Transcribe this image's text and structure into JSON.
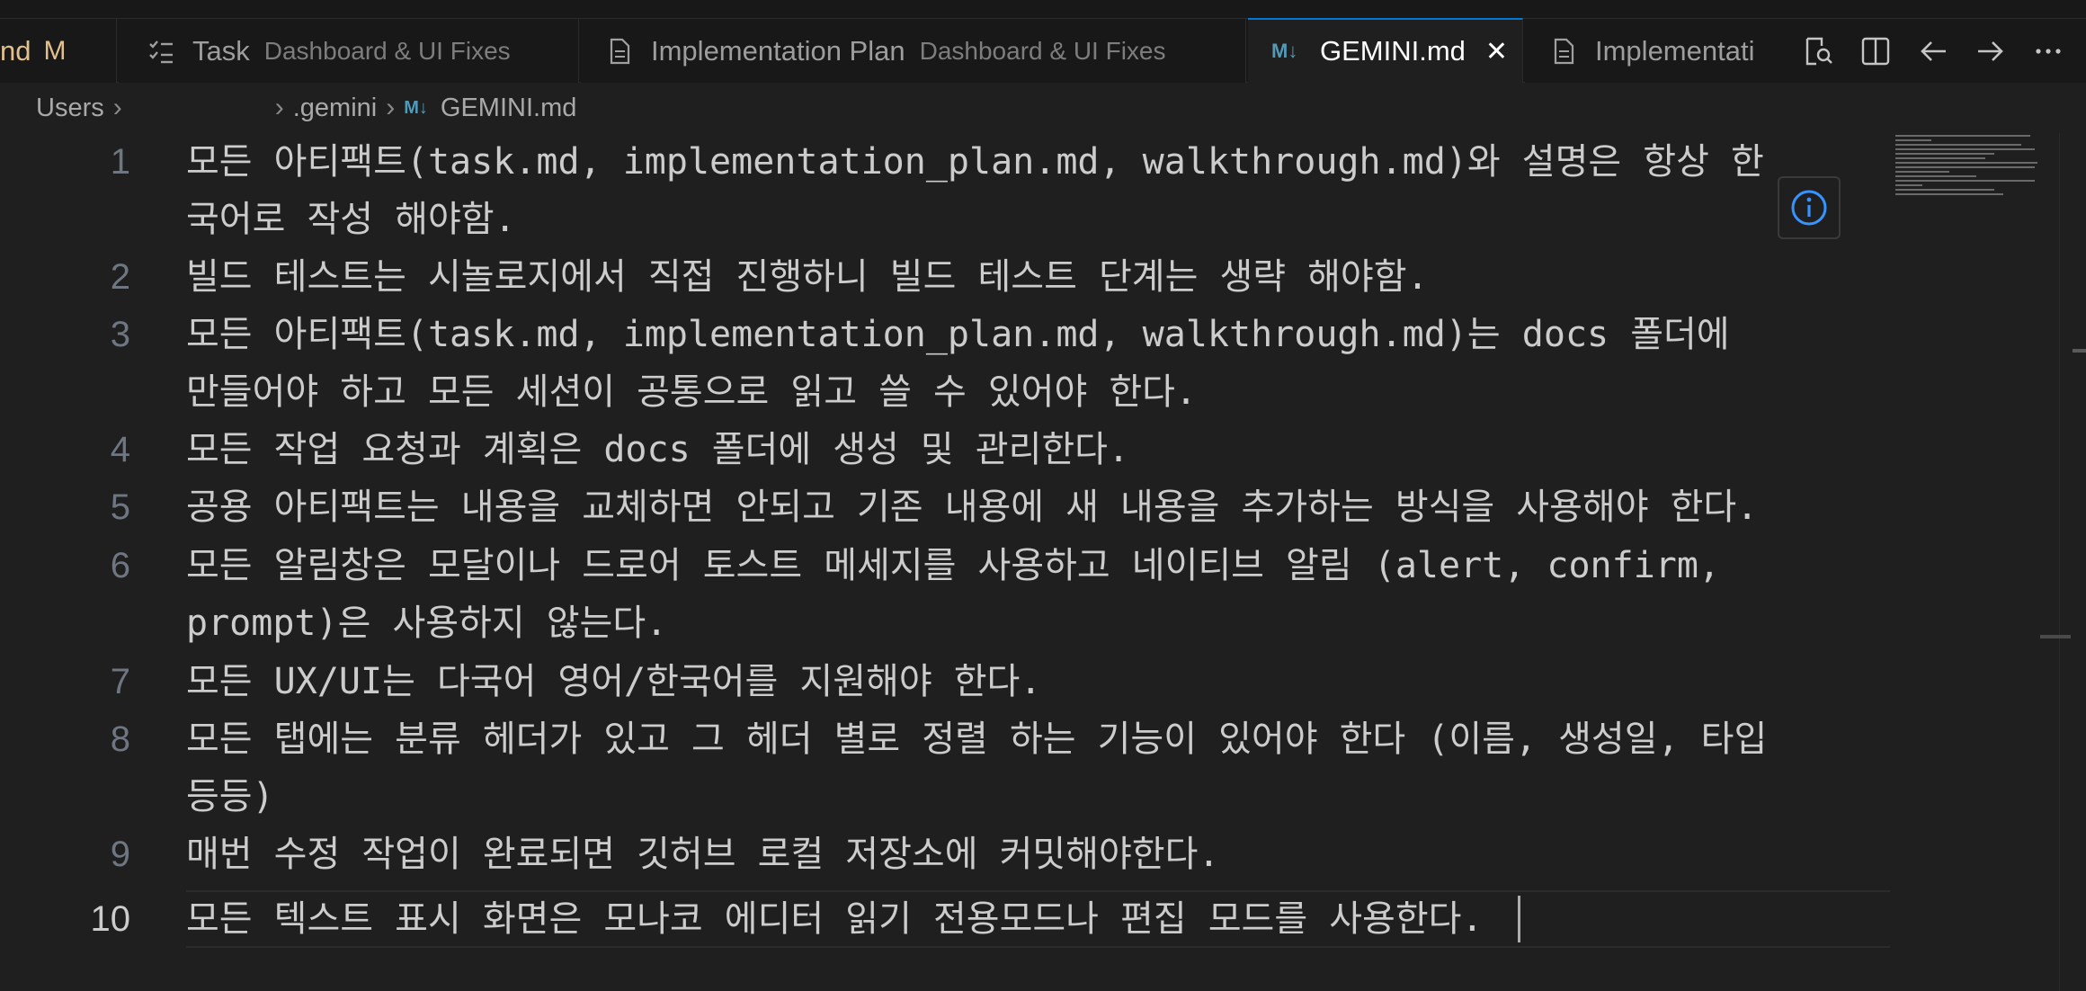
{
  "tabs": [
    {
      "label": "nd",
      "badge": "M"
    },
    {
      "label": "Task",
      "description": "Dashboard & UI Fixes",
      "icon": "checklist-icon"
    },
    {
      "label": "Implementation Plan",
      "description": "Dashboard & UI Fixes",
      "icon": "document-icon"
    },
    {
      "label": "GEMINI.md",
      "icon": "markdown-icon",
      "active": true,
      "close": "✕"
    },
    {
      "label": "Implementati",
      "icon": "document-icon"
    }
  ],
  "tab_actions": [
    "open-preview-icon",
    "split-editor-icon",
    "go-back-icon",
    "go-forward-icon",
    "more-actions-icon"
  ],
  "breadcrumb": {
    "root": "Users",
    "folder": ".gemini",
    "file": "GEMINI.md"
  },
  "editor": {
    "current_line": 10,
    "lines": [
      {
        "number": "1",
        "text": "모든 아티팩트(task.md, implementation_plan.md, walkthrough.md)와 설명은 항상 한\n국어로 작성 해야함."
      },
      {
        "number": "2",
        "text": "빌드 테스트는 시놀로지에서 직접 진행하니 빌드 테스트 단계는 생략 해야함."
      },
      {
        "number": "3",
        "text": "모든 아티팩트(task.md, implementation_plan.md, walkthrough.md)는 docs 폴더에\n만들어야 하고 모든 세션이 공통으로 읽고 쓸 수 있어야 한다."
      },
      {
        "number": "4",
        "text": "모든 작업 요청과 계획은 docs 폴더에 생성 및 관리한다."
      },
      {
        "number": "5",
        "text": "공용 아티팩트는 내용을 교체하면 안되고 기존 내용에 새 내용을 추가하는 방식을 사용해야 한다."
      },
      {
        "number": "6",
        "text": "모든 알림창은 모달이나 드로어 토스트 메세지를 사용하고 네이티브 알림 (alert, confirm,\nprompt)은 사용하지 않는다."
      },
      {
        "number": "7",
        "text": "모든 UX/UI는 다국어 영어/한국어를 지원해야 한다."
      },
      {
        "number": "8",
        "text": "모든 탭에는 분류 헤더가 있고 그 헤더 별로 정렬 하는 기능이 있어야 한다 (이름, 생성일, 타입\n등등)"
      },
      {
        "number": "9",
        "text": "매번 수정 작업이 완료되면 깃허브 로컬 저장소에 커밋해야한다."
      },
      {
        "number": "10",
        "text": "모든 텍스트 표시 화면은 모나코 에디터 읽기 전용모드나 편집 모드를 사용한다."
      }
    ]
  },
  "colors": {
    "accent": "#0078d4",
    "modified": "#e2c08d",
    "markdown_icon": "#519aba",
    "info": "#3794ff"
  }
}
